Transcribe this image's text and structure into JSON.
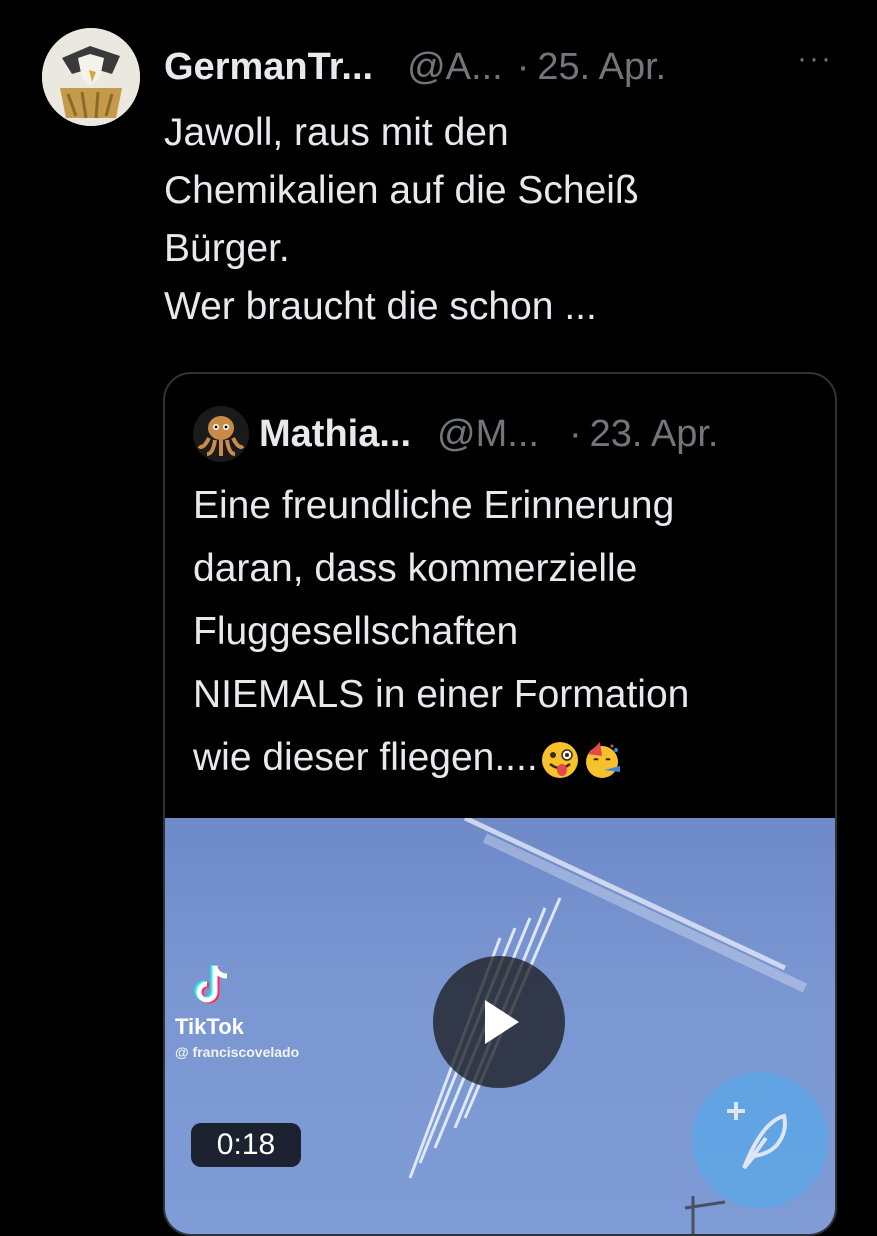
{
  "tweet": {
    "display_name": "GermanTr...",
    "handle": "@A...",
    "separator": "·",
    "date": "25. Apr.",
    "more_icon": "···",
    "text_lines": [
      "Jawoll, raus mit den",
      "Chemikalien auf die Scheiß",
      "Bürger.",
      "Wer braucht die schon ..."
    ]
  },
  "quoted": {
    "display_name": "Mathia...",
    "handle": "@M...",
    "separator": "·",
    "date": "23. Apr.",
    "text_lines": [
      "Eine freundliche Erinnerung",
      "daran, dass kommerzielle",
      "Fluggesellschaften",
      "NIEMALS in einer Formation",
      "wie dieser fliegen...."
    ],
    "emojis": [
      "winking-face-with-tongue-icon",
      "partying-face-icon"
    ],
    "media": {
      "watermark_brand": "TikTok",
      "watermark_user": "@ franciscovelado",
      "duration": "0:18",
      "play_icon": "play-icon"
    }
  },
  "compose_button": {
    "icon": "compose-feather-plus-icon"
  },
  "colors": {
    "background": "#000000",
    "text": "#e7e9ea",
    "muted": "#71767b",
    "accent": "#1d9bf0",
    "border": "#2f3336"
  }
}
